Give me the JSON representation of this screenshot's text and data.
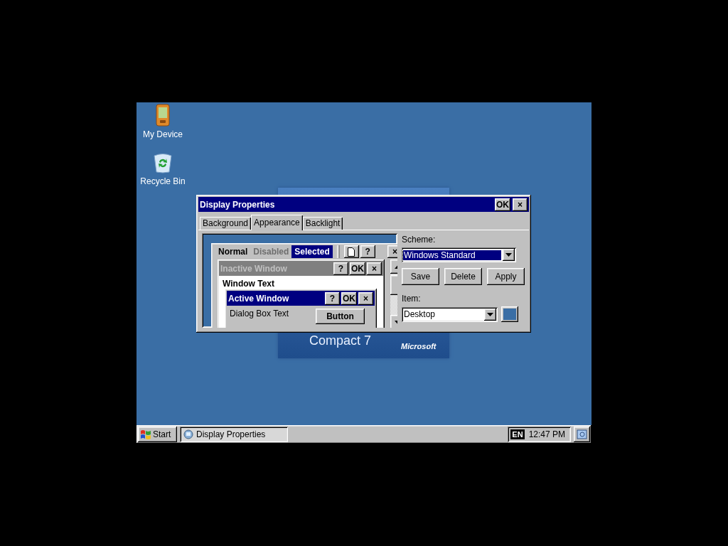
{
  "desktop_icons": [
    {
      "label": "My Device",
      "kind": "device"
    },
    {
      "label": "Recycle Bin",
      "kind": "recycle"
    }
  ],
  "wallpaper": {
    "product": "Compact 7",
    "brand": "Microsoft"
  },
  "dialog": {
    "title": "Display Properties",
    "ok": "OK",
    "close": "×",
    "tabs": [
      {
        "label": "Background",
        "selected": false
      },
      {
        "label": "Appearance",
        "selected": true
      },
      {
        "label": "Backlight",
        "selected": false
      }
    ],
    "preview": {
      "menu": [
        {
          "label": "Normal",
          "kind": "normal"
        },
        {
          "label": "Disabled",
          "kind": "disabled"
        },
        {
          "label": "Selected",
          "kind": "selected"
        }
      ],
      "help": "?",
      "close": "×",
      "inactive_window": {
        "title": "Inactive Window",
        "help": "?",
        "ok": "OK",
        "close": "×"
      },
      "window_text": "Window Text",
      "active_window": {
        "title": "Active Window",
        "help": "?",
        "ok": "OK",
        "close": "×"
      },
      "dialog_text": "Dialog Box Text",
      "button": "Button"
    },
    "scheme_label": "Scheme:",
    "scheme": "Windows Standard",
    "buttons": [
      "Save",
      "Delete",
      "Apply"
    ],
    "item_label": "Item:",
    "item": "Desktop"
  },
  "taskbar": {
    "start": "Start",
    "task": "Display Properties",
    "language": "EN",
    "time": "12:47 PM"
  }
}
